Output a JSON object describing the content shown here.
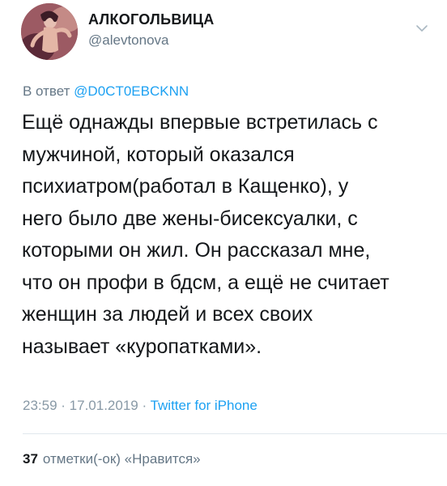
{
  "author": {
    "display_name": "АЛКОГОЛЬВИЦА",
    "username": "@alevtonova",
    "avatar_icon": "profile-photo"
  },
  "menu_icon": "chevron-down-icon",
  "reply": {
    "prefix": "В ответ ",
    "mention": "@D0CT0EBCKNN"
  },
  "tweet_text": "Ещё однажды впервые встретилась с\nмужчиной, который оказался\nпсихиатром(работал в Кащенко), у\nнего было две жены-бисексуалки, с\nкоторыми он жил. Он рассказал мне,\nчто он профи в бдсм, а ещё не считает\nженщин за людей и всех своих\nназывает «куропатками».",
  "meta": {
    "time": "23:59",
    "separator": " · ",
    "date": "17.01.2019",
    "source": "Twitter for iPhone"
  },
  "likes": {
    "count": "37",
    "label": "отметки(-ок) «Нравится»"
  },
  "colors": {
    "link": "#1da1f2",
    "secondary": "#657786",
    "text": "#14171a",
    "divider": "#e1e8ed"
  }
}
